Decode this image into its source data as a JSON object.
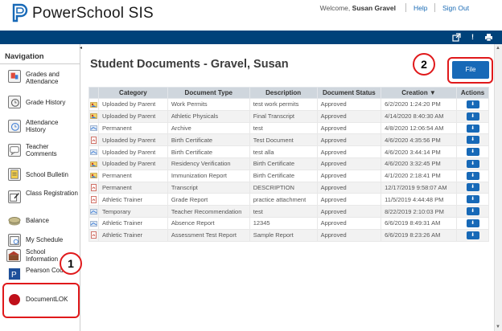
{
  "header": {
    "app_name": "PowerSchool SIS",
    "welcome_prefix": "Welcome,",
    "user_name": "Susan Gravel",
    "help_label": "Help",
    "signout_label": "Sign Out"
  },
  "topbar": {
    "icons": [
      "external-link-icon",
      "alert-icon",
      "print-icon"
    ],
    "exclamation": "!"
  },
  "navigation": {
    "title": "Navigation",
    "items": [
      {
        "label": "Grades and Attendance",
        "icon": "grades-icon"
      },
      {
        "label": "Grade History",
        "icon": "grade-history-icon"
      },
      {
        "label": "Attendance History",
        "icon": "attendance-history-icon"
      },
      {
        "label": "Teacher Comments",
        "icon": "comments-icon"
      },
      {
        "label": "School Bulletin",
        "icon": "bulletin-icon"
      },
      {
        "label": "Class Registration",
        "icon": "registration-icon"
      },
      {
        "label": "Balance",
        "icon": "balance-icon"
      },
      {
        "label": "My Schedule",
        "icon": "schedule-icon"
      },
      {
        "label": "School Information",
        "icon": "school-icon"
      },
      {
        "label": "Pearson Courses",
        "icon": "pearson-icon"
      },
      {
        "label": "DocumentLOK",
        "icon": "documentlok-icon"
      }
    ]
  },
  "annotations": {
    "badge_1": "1",
    "badge_2": "2"
  },
  "main": {
    "title": "Student Documents - Gravel, Susan",
    "file_button": "File",
    "columns": [
      "",
      "Category",
      "Document Type",
      "Description",
      "Document Status",
      "Creation ▼",
      "Actions"
    ],
    "action_glyph": "⬇",
    "rows": [
      {
        "icon": "photo-icon",
        "category": "Uploaded by Parent",
        "type": "Work Permits",
        "description": "test work permits",
        "status": "Approved",
        "created": "6/2/2020 1:24:20 PM"
      },
      {
        "icon": "photo-icon",
        "category": "Uploaded by Parent",
        "type": "Athletic Physicals",
        "description": "Final Transcript",
        "status": "Approved",
        "created": "4/14/2020 8:40:30 AM"
      },
      {
        "icon": "image-icon",
        "category": "Permanent",
        "type": "Archive",
        "description": "test",
        "status": "Approved",
        "created": "4/8/2020 12:06:54 AM"
      },
      {
        "icon": "pdf-icon",
        "category": "Uploaded by Parent",
        "type": "Birth Certificate",
        "description": "Test Document",
        "status": "Approved",
        "created": "4/6/2020 4:35:56 PM"
      },
      {
        "icon": "image-icon",
        "category": "Uploaded by Parent",
        "type": "Birth Certificate",
        "description": "test alla",
        "status": "Approved",
        "created": "4/6/2020 3:44:14 PM"
      },
      {
        "icon": "photo-icon",
        "category": "Uploaded by Parent",
        "type": "Residency Verification",
        "description": "Birth Certificate",
        "status": "Approved",
        "created": "4/6/2020 3:32:45 PM"
      },
      {
        "icon": "photo-icon",
        "category": "Permanent",
        "type": "Immunization Report",
        "description": "Birth Certificate",
        "status": "Approved",
        "created": "4/1/2020 2:18:41 PM"
      },
      {
        "icon": "pdf-icon",
        "category": "Permanent",
        "type": "Transcript",
        "description": "DESCRIPTION",
        "status": "Approved",
        "created": "12/17/2019 9:58:07 AM"
      },
      {
        "icon": "pdf-icon",
        "category": "Athletic Trainer",
        "type": "Grade Report",
        "description": "practice attachment",
        "status": "Approved",
        "created": "11/5/2019 4:44:48 PM"
      },
      {
        "icon": "image-icon",
        "category": "Temporary",
        "type": "Teacher Recommendation",
        "description": "test",
        "status": "Approved",
        "created": "8/22/2019 2:10:03 PM"
      },
      {
        "icon": "image-icon",
        "category": "Athletic Trainer",
        "type": "Absence Report",
        "description": "12345",
        "status": "Approved",
        "created": "6/6/2019 8:49:31 AM"
      },
      {
        "icon": "pdf-icon",
        "category": "Athletic Trainer",
        "type": "Assessment Test Report",
        "description": "Sample Report",
        "status": "Approved",
        "created": "6/6/2019 8:23:26 AM"
      }
    ]
  },
  "colors": {
    "topbar": "#00427a",
    "accent": "#1769b7",
    "highlight": "#e0191b"
  }
}
